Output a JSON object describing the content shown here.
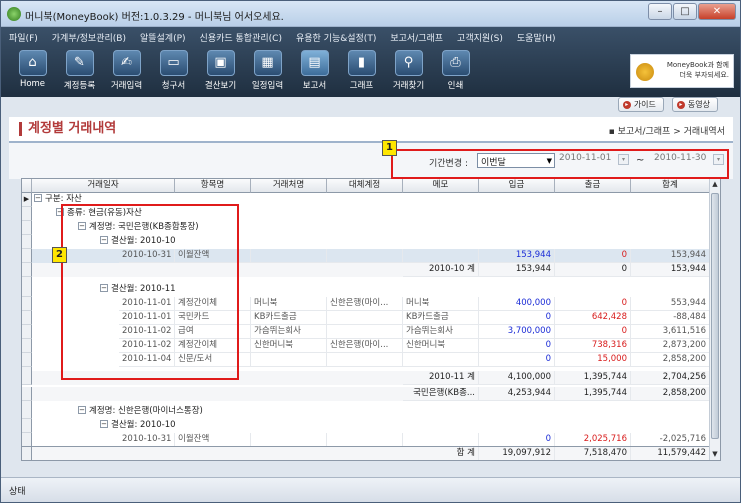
{
  "window": {
    "title": "머니북(MoneyBook) 버전:1.0.3.29 - 머니북님 어서오세요."
  },
  "menu": [
    "파일(F)",
    "가계부/정보관리(B)",
    "알뜰설계(P)",
    "신용카드 통합관리(C)",
    "유용한 기능&설정(T)",
    "보고서/그래프",
    "고객지원(S)",
    "도움말(H)"
  ],
  "toolbar": [
    {
      "label": "Home",
      "icon": "home-icon",
      "glyph": "⌂"
    },
    {
      "label": "계정등록",
      "icon": "account-register-icon",
      "glyph": "✎"
    },
    {
      "label": "거래입력",
      "icon": "transaction-input-icon",
      "glyph": "✍"
    },
    {
      "label": "청구서",
      "icon": "bill-icon",
      "glyph": "▭"
    },
    {
      "label": "결산보기",
      "icon": "settlement-icon",
      "glyph": "▣"
    },
    {
      "label": "일정입력",
      "icon": "calendar-icon",
      "glyph": "▦"
    },
    {
      "label": "보고서",
      "icon": "report-icon",
      "glyph": "▤"
    },
    {
      "label": "그래프",
      "icon": "graph-icon",
      "glyph": "▮"
    },
    {
      "label": "거래찾기",
      "icon": "search-icon",
      "glyph": "⚲"
    },
    {
      "label": "인쇄",
      "icon": "print-icon",
      "glyph": "⎙"
    }
  ],
  "banner": {
    "line1": "MoneyBook과 함께",
    "line2": "더욱 부자되세요."
  },
  "guide": {
    "guide_label": "가이드",
    "video_label": "동영상"
  },
  "page": {
    "title": "계정별 거래내역",
    "breadcrumb": "▪ 보고서/그래프 > 거래내역서"
  },
  "filter": {
    "period_label": "기간변경 :",
    "period_value": "이번달",
    "date_from": "2010-11-01",
    "tilde": "~",
    "date_to": "2010-11-30"
  },
  "annotations": {
    "one": "1",
    "two": "2"
  },
  "grid": {
    "columns": [
      "거래일자",
      "항목명",
      "거래처명",
      "대체계정",
      "메모",
      "입금",
      "출금",
      "합계"
    ],
    "tree": {
      "group": "구분: 자산",
      "kind": "종류: 현금(유동)자산",
      "account1": "계정명: 국민은행(KB종합통장)",
      "month1": "결산월: 2010-10",
      "month2": "결산월: 2010-11",
      "account2": "계정명: 신한은행(마이너스통장)",
      "month3": "결산월: 2010-10"
    },
    "oct_rows": [
      {
        "date": "2010-10-31",
        "item": "이월잔액",
        "client": "",
        "alt": "",
        "memo": "",
        "in": "153,944",
        "out": "0",
        "sum": "153,944"
      }
    ],
    "oct_total": {
      "label": "2010-10 계",
      "in": "153,944",
      "out": "0",
      "sum": "153,944"
    },
    "nov_rows": [
      {
        "date": "2010-11-01",
        "item": "계정간이체",
        "client": "머니북",
        "alt": "신한은행(마이...",
        "memo": "머니북",
        "in": "400,000",
        "out": "0",
        "sum": "553,944"
      },
      {
        "date": "2010-11-01",
        "item": "국민카드",
        "client": "KB카드출금",
        "alt": "",
        "memo": "KB카드출금",
        "in": "0",
        "out": "642,428",
        "sum": "-88,484"
      },
      {
        "date": "2010-11-02",
        "item": "급여",
        "client": "가슴뛰는회사",
        "alt": "",
        "memo": "가슴뛰는회사",
        "in": "3,700,000",
        "out": "0",
        "sum": "3,611,516"
      },
      {
        "date": "2010-11-02",
        "item": "계정간이체",
        "client": "신한머니북",
        "alt": "신한은행(마이...",
        "memo": "신한머니북",
        "in": "0",
        "out": "738,316",
        "sum": "2,873,200"
      },
      {
        "date": "2010-11-04",
        "item": "신문/도서",
        "client": "",
        "alt": "",
        "memo": "",
        "in": "0",
        "out": "15,000",
        "sum": "2,858,200"
      }
    ],
    "nov_total": {
      "label": "2010-11 계",
      "in": "4,100,000",
      "out": "1,395,744",
      "sum": "2,704,256"
    },
    "acct_total": {
      "label": "국민은행(KB종...",
      "in": "4,253,944",
      "out": "1,395,744",
      "sum": "2,858,200"
    },
    "shinhan_rows": [
      {
        "date": "2010-10-31",
        "item": "이월잔액",
        "client": "",
        "alt": "",
        "memo": "",
        "in": "0",
        "out": "2,025,716",
        "sum": "-2,025,716"
      }
    ],
    "grand_total": {
      "label": "합 계",
      "in": "19,097,912",
      "out": "7,518,470",
      "sum": "11,579,442"
    }
  },
  "status": {
    "text": "상태"
  }
}
